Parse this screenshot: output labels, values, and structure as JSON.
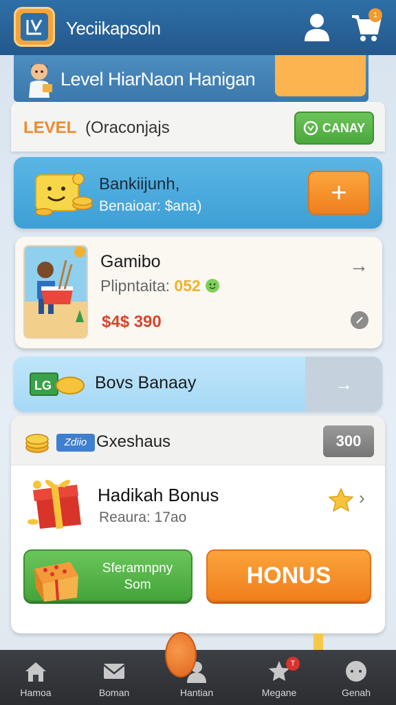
{
  "header": {
    "title": "Yeciikapsoln",
    "cart_badge": "1"
  },
  "level_banner": {
    "title": "Level HiarNaon Hanigan"
  },
  "level_row": {
    "label": "LEVEL",
    "value": "(Oraconjajs",
    "button_label": "CANAY"
  },
  "bank_card": {
    "title": "Bankiijunh,",
    "subtitle": "Benaioar: $ana)",
    "add_label": "+"
  },
  "game_card": {
    "title": "Gamibo",
    "players_label": "Plipntaita:",
    "players_value": "052",
    "price": "$4$ 390",
    "arrow": "→"
  },
  "boost_row": {
    "badge": "LG",
    "title": "Bovs Banaay",
    "arrow": "→"
  },
  "bonus_panel": {
    "coin_label": "Zdiio",
    "title": "Gxeshaus",
    "count": "300",
    "item_title": "Hadikah Bonus",
    "item_reward": "Reaura: 17ao",
    "chevron": "›",
    "green_button_label": "Sferamnpny Som",
    "orange_button_label": "HONUS"
  },
  "bottom_nav": {
    "items": [
      {
        "label": "Hamoa",
        "icon": "home-icon"
      },
      {
        "label": "Boman",
        "icon": "mail-icon"
      },
      {
        "label": "Hantian",
        "icon": "person-icon"
      },
      {
        "label": "Megane",
        "icon": "badge-icon"
      },
      {
        "label": "Genah",
        "icon": "chat-icon"
      }
    ],
    "notification_badge": "T"
  },
  "colors": {
    "header": "#2e6fa7",
    "accent_orange": "#f07f1d",
    "accent_green": "#4aa83c",
    "bank_blue": "#3e9fd5",
    "price_red": "#d5452e"
  }
}
